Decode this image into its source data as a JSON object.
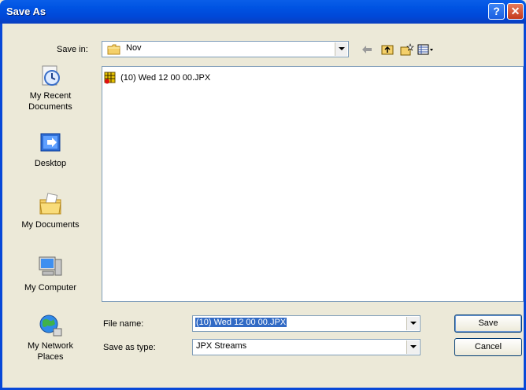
{
  "window": {
    "title": "Save As"
  },
  "toolbar": {
    "save_in_label": "Save in:",
    "current_folder": "Nov"
  },
  "places": [
    {
      "label_line1": "My Recent",
      "label_line2": "Documents"
    },
    {
      "label_line1": "Desktop",
      "label_line2": ""
    },
    {
      "label_line1": "My Documents",
      "label_line2": ""
    },
    {
      "label_line1": "My Computer",
      "label_line2": ""
    },
    {
      "label_line1": "My Network",
      "label_line2": "Places"
    }
  ],
  "files": [
    {
      "name": "(10) Wed 12 00 00.JPX"
    }
  ],
  "form": {
    "file_name_label": "File name:",
    "file_name_value": "(10) Wed 12 00 00.JPX",
    "save_type_label": "Save as type:",
    "save_type_value": "JPX Streams"
  },
  "buttons": {
    "save": "Save",
    "cancel": "Cancel"
  },
  "colors": {
    "title_bar": "#0054e3",
    "dialog_bg": "#ece9d8",
    "selection": "#316ac5"
  }
}
